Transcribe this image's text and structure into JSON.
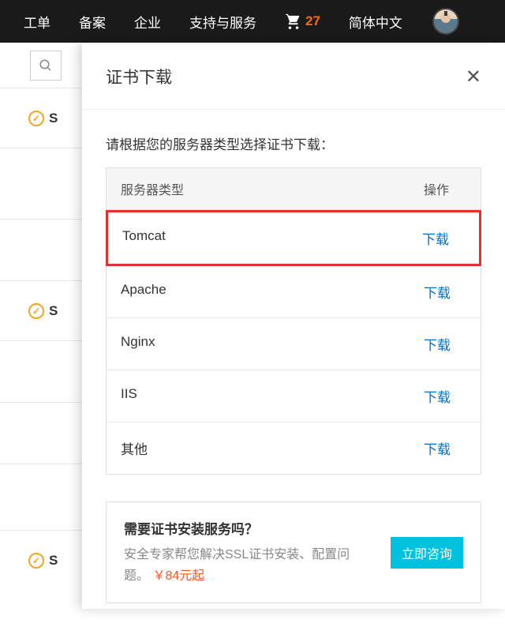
{
  "topnav": {
    "items": [
      "工单",
      "备案",
      "企业",
      "支持与服务"
    ],
    "cart_count": "27",
    "lang": "简体中文"
  },
  "bg_rows": [
    {
      "label": "S"
    },
    {
      "label": "S"
    },
    {
      "label": "S"
    }
  ],
  "panel": {
    "title": "证书下载",
    "instruction": "请根据您的服务器类型选择证书下载：",
    "columns": {
      "type": "服务器类型",
      "op": "操作"
    },
    "rows": [
      {
        "type": "Tomcat",
        "op": "下载",
        "highlight": true
      },
      {
        "type": "Apache",
        "op": "下载"
      },
      {
        "type": "Nginx",
        "op": "下载"
      },
      {
        "type": "IIS",
        "op": "下载"
      },
      {
        "type": "其他",
        "op": "下载"
      }
    ],
    "promo": {
      "title": "需要证书安装服务吗？",
      "desc_prefix": "安全专家帮您解决SSL证书安装、配置问",
      "desc_suffix": "题。",
      "price": "￥84元起",
      "button": "立即咨询"
    }
  }
}
